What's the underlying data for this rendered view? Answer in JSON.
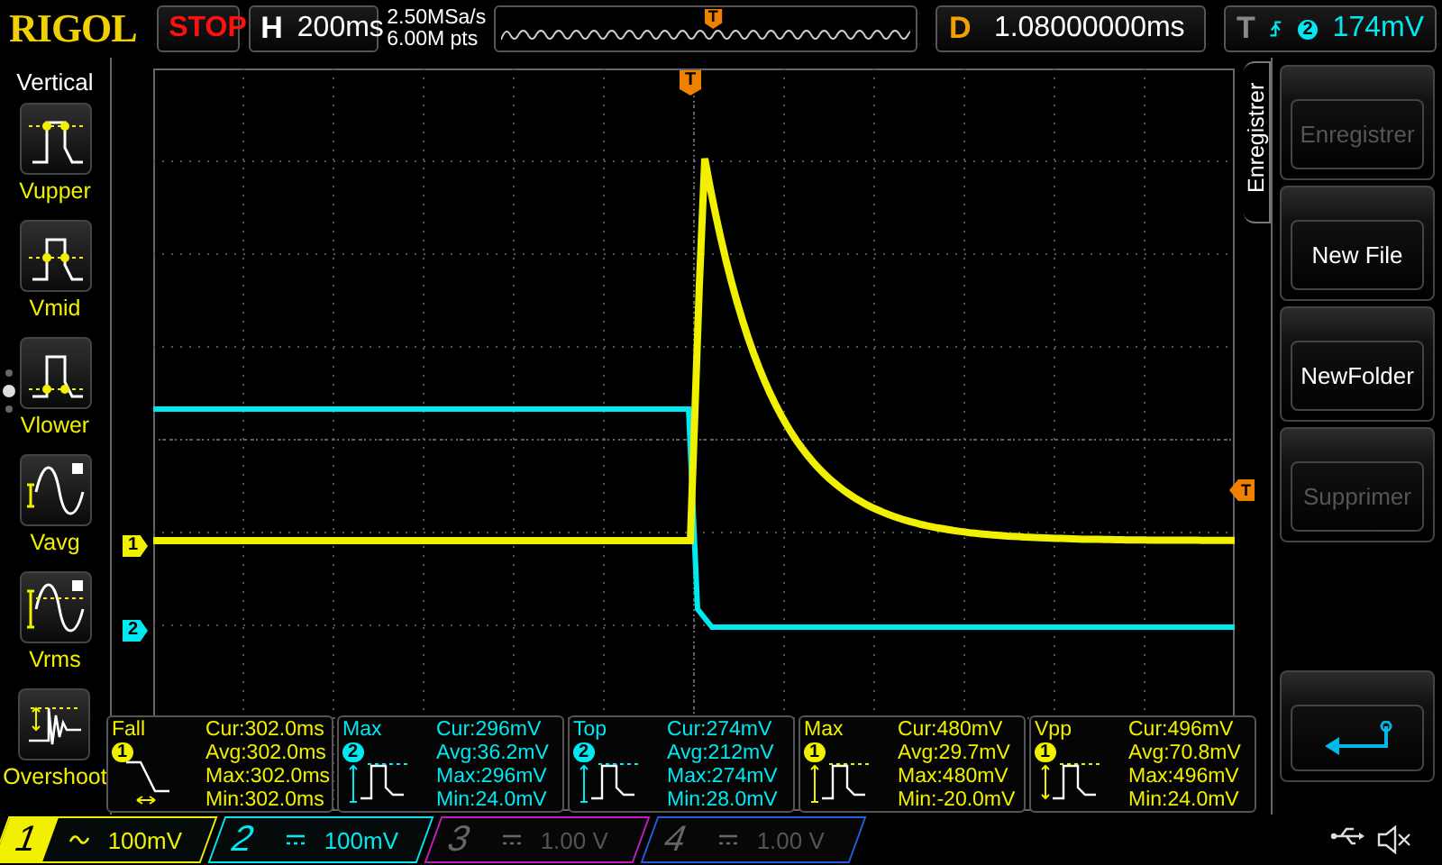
{
  "brand": "RIGOL",
  "run_state": "STOP",
  "horizontal": {
    "label": "H",
    "timebase": "200ms"
  },
  "acquisition": {
    "sample_rate": "2.50MSa/s",
    "memory_depth": "6.00M pts",
    "trigger_label": "T"
  },
  "delay": {
    "label": "D",
    "value": "1.08000000ms"
  },
  "trigger": {
    "label": "T",
    "source": "2",
    "level": "174mV"
  },
  "left_menu": {
    "title": "Vertical",
    "items": [
      {
        "label": "Vupper",
        "kind": "upper"
      },
      {
        "label": "Vmid",
        "kind": "mid"
      },
      {
        "label": "Vlower",
        "kind": "lower"
      },
      {
        "label": "Vavg",
        "kind": "avg"
      },
      {
        "label": "Vrms",
        "kind": "rms"
      },
      {
        "label": "Overshoot",
        "kind": "overshoot"
      }
    ]
  },
  "right_menu": {
    "tab": "Enregistrer",
    "buttons": [
      {
        "label": "Enregistrer",
        "disabled": true
      },
      {
        "label": "New File",
        "disabled": false
      },
      {
        "label": "NewFolder",
        "disabled": false
      },
      {
        "label": "Supprimer",
        "disabled": true
      }
    ]
  },
  "scope": {
    "trigger_position_label": "T",
    "trigger_level_label": "T",
    "trace_markers": [
      {
        "label": "1",
        "color": "#f0f000"
      },
      {
        "label": "2",
        "color": "#00e8f0"
      }
    ]
  },
  "measurements": [
    {
      "name": "Fall",
      "kind": "fall",
      "channel": "1",
      "color": "#f0f000",
      "lines": [
        "Cur:302.0ms",
        "Avg:302.0ms",
        "Max:302.0ms",
        "Min:302.0ms"
      ]
    },
    {
      "name": "Max",
      "kind": "max",
      "channel": "2",
      "color": "#00e8f0",
      "lines": [
        "Cur:296mV",
        "Avg:36.2mV",
        "Max:296mV",
        "Min:24.0mV"
      ]
    },
    {
      "name": "Top",
      "kind": "top",
      "channel": "2",
      "color": "#00e8f0",
      "lines": [
        "Cur:274mV",
        "Avg:212mV",
        "Max:274mV",
        "Min:28.0mV"
      ]
    },
    {
      "name": "Max",
      "kind": "max",
      "channel": "1",
      "color": "#f0f000",
      "lines": [
        "Cur:480mV",
        "Avg:29.7mV",
        "Max:480mV",
        "Min:-20.0mV"
      ]
    },
    {
      "name": "Vpp",
      "kind": "vpp",
      "channel": "1",
      "color": "#f0f000",
      "lines": [
        "Cur:496mV",
        "Avg:70.8mV",
        "Max:496mV",
        "Min:24.0mV"
      ]
    }
  ],
  "channels": [
    {
      "number": "1",
      "kind": "ac",
      "scale": "100mV",
      "enabled": true,
      "selected": true,
      "color": "#f0f000"
    },
    {
      "number": "2",
      "kind": "dc",
      "scale": "100mV",
      "enabled": true,
      "selected": false,
      "color": "#00e8f0"
    },
    {
      "number": "3",
      "kind": "dc",
      "scale": "1.00 V",
      "enabled": false,
      "selected": false,
      "color": "#c020c0"
    },
    {
      "number": "4",
      "kind": "dc",
      "scale": "1.00 V",
      "enabled": false,
      "selected": false,
      "color": "#2060e0"
    }
  ]
}
